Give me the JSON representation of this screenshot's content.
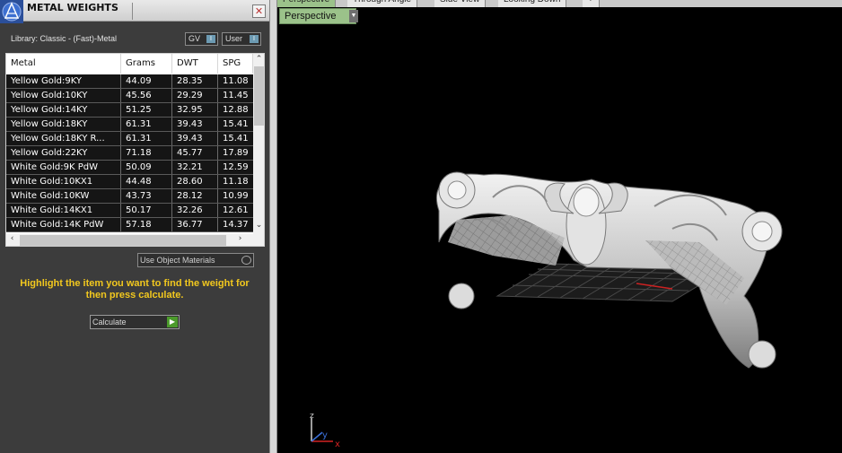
{
  "panel": {
    "title": "METAL WEIGHTS",
    "close_glyph": "✕",
    "library_label": "Library: Classic - (Fast)-Metal",
    "toggle_gv": "GV",
    "toggle_user": "User",
    "toggle_knob": "I",
    "use_object_materials": "Use Object Materials",
    "hint": "Highlight the item you want to find the weight for then press calculate.",
    "calculate": "Calculate",
    "calc_icon": "play-arrow-icon"
  },
  "table": {
    "columns": [
      "Metal",
      "Grams",
      "DWT",
      "SPG"
    ],
    "rows": [
      [
        "Yellow Gold:9KY",
        "44.09",
        "28.35",
        "11.08"
      ],
      [
        "Yellow Gold:10KY",
        "45.56",
        "29.29",
        "11.45"
      ],
      [
        "Yellow Gold:14KY",
        "51.25",
        "32.95",
        "12.88"
      ],
      [
        "Yellow Gold:18KY",
        "61.31",
        "39.43",
        "15.41"
      ],
      [
        "Yellow Gold:18KY R...",
        "61.31",
        "39.43",
        "15.41"
      ],
      [
        "Yellow Gold:22KY",
        "71.18",
        "45.77",
        "17.89"
      ],
      [
        "White Gold:9K PdW",
        "50.09",
        "32.21",
        "12.59"
      ],
      [
        "White Gold:10KX1",
        "44.48",
        "28.60",
        "11.18"
      ],
      [
        "White Gold:10KW",
        "43.73",
        "28.12",
        "10.99"
      ],
      [
        "White Gold:14KX1",
        "50.17",
        "32.26",
        "12.61"
      ],
      [
        "White Gold:14K PdW",
        "57.18",
        "36.77",
        "14.37"
      ]
    ]
  },
  "viewport": {
    "tabs": [
      "Perspective",
      "Through Angle",
      "Side View",
      "Looking Down",
      "+"
    ],
    "active_tab": 0,
    "view_label": "Perspective",
    "axis_x": "x",
    "axis_y": "y",
    "axis_z": "z"
  },
  "colors": {
    "hint_text": "#f2c81e",
    "view_label_bg": "#9bc28a",
    "calc_green": "#4b9a2b",
    "axis_x": "#d22222",
    "axis_y": "#3a6fd8",
    "axis_z": "#d0d0d0"
  }
}
